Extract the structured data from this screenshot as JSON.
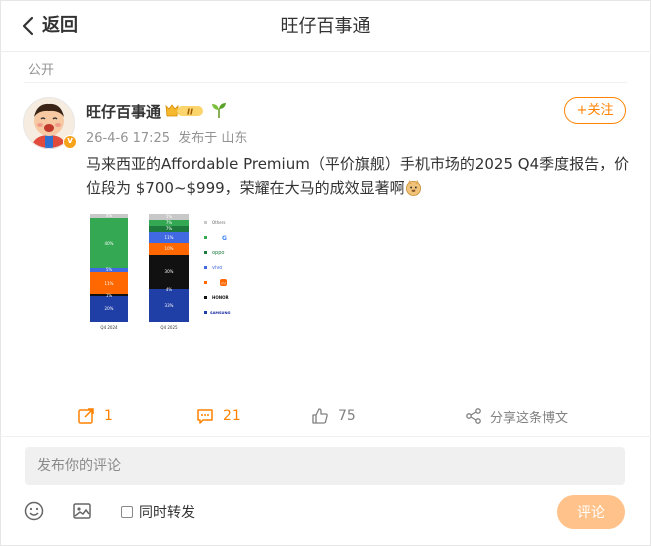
{
  "header": {
    "back_label": "返回",
    "title": "旺仔百事通"
  },
  "scope_label": "公开",
  "post": {
    "author": "旺仔百事通",
    "level_badge": "II",
    "timestamp": "26-4-6 17:25",
    "source": "发布于 山东",
    "follow_label": "+关注",
    "text": "马来西亚的Affordable Premium（平价旗舰）手机市场的2025 Q4季度报告，价位段为 $700~$999，荣耀在大马的成效显著啊",
    "image": {
      "bar_labels": [
        "Q4 2024",
        "Q4 2025"
      ],
      "q4_2024_segments": [
        "4%",
        "40%",
        "5%",
        "11%",
        "1%",
        "20%"
      ],
      "q4_2025_segments": [
        "5%",
        "7%",
        "7%",
        "11%",
        "10%",
        "30%",
        "4%",
        "33%"
      ],
      "legend": [
        "Others",
        "G",
        "oppo",
        "vivo",
        "mi",
        "HONOR",
        "SAMSUNG"
      ],
      "colors": {
        "others": "#c8c8c8",
        "google": "#34a853",
        "oppo": "#1e7a3c",
        "vivo": "#4169e1",
        "xiaomi": "#ff6700",
        "honor": "#111111",
        "samsung": "#1f3ea6"
      }
    }
  },
  "actions": {
    "repost_count": "1",
    "comment_count": "21",
    "like_count": "75",
    "share_label": "分享这条博文"
  },
  "composer": {
    "placeholder": "发布你的评论",
    "forward_label": "同时转发",
    "submit_label": "评论"
  },
  "colors": {
    "accent": "#ff8200",
    "submit_disabled": "#ffc28a"
  }
}
